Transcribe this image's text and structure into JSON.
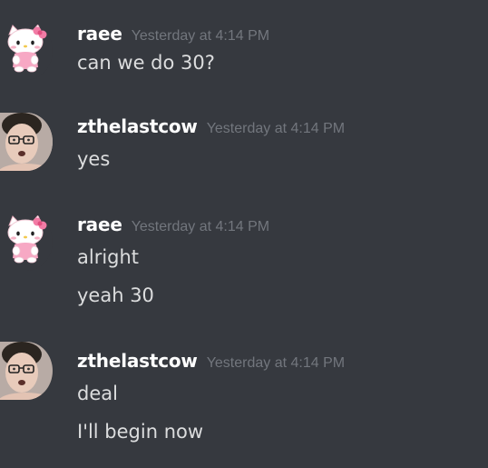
{
  "messages": [
    {
      "author": "raee",
      "avatar_icon": "hello-kitty-icon",
      "timestamp": "Yesterday at 4:14 PM",
      "lines": [
        "can we do 30?"
      ]
    },
    {
      "author": "zthelastcow",
      "avatar_icon": "user-photo-icon",
      "timestamp": "Yesterday at 4:14 PM",
      "lines": [
        "yes"
      ]
    },
    {
      "author": "raee",
      "avatar_icon": "hello-kitty-icon",
      "timestamp": "Yesterday at 4:14 PM",
      "lines": [
        "alright",
        "yeah 30"
      ]
    },
    {
      "author": "zthelastcow",
      "avatar_icon": "user-photo-icon",
      "timestamp": "Yesterday at 4:14 PM",
      "lines": [
        "deal",
        "I'll begin now"
      ]
    }
  ],
  "colors": {
    "background": "#36393f",
    "username": "#ffffff",
    "timestamp": "#72767d",
    "message_text": "#dcddde"
  }
}
